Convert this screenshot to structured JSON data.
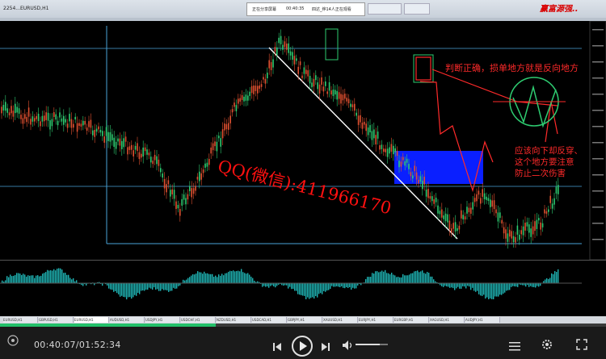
{
  "titlebar": {
    "window_title": "2254...EURUSD,H1",
    "notice_left": "正在分享屏幕",
    "notice_time": "00:40:35",
    "notice_right": "四达_烨14人正在观看",
    "brand": "赢富源强.."
  },
  "annotations": {
    "watermark": "QQ(微信):411966170",
    "note_top": "判断正确，损单地方就是反向地方",
    "note_lines": [
      "应该向下却反穿、",
      "这个地方要注意",
      "防止二次伤害"
    ]
  },
  "symbol_tabs": [
    "EURUSD,H1",
    "GBPUSD,H1",
    "EURUSD,H1",
    "AUDUSD,H1",
    "USDJPY,H1",
    "USDCHF,H1",
    "NZDUSD,H1",
    "USDCAD,H1",
    "GBPJPY,H1",
    "XAUUSD,H1",
    "EURJPY,H1",
    "EURGBP,H1",
    "XAGUSD,H1",
    "AUDJPY,H1"
  ],
  "player": {
    "current_time": "00:40:07",
    "total_time": "01:52:34",
    "progress_percent": 35.6,
    "accent": "#23c06a"
  },
  "icons": [
    "play-icon",
    "previous-icon",
    "next-icon",
    "volume-icon",
    "list-icon",
    "settings-icon",
    "fullscreen-icon"
  ]
}
